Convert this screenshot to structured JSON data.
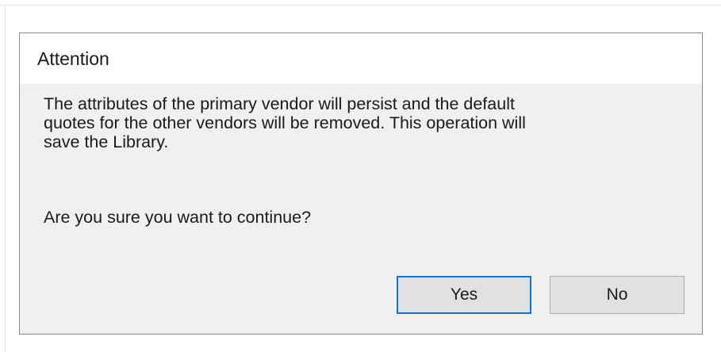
{
  "dialog": {
    "title": "Attention",
    "message_lines": [
      "The attributes of the primary vendor will persist and the default",
      "quotes for the other vendors will be removed.  This operation will",
      "save the Library."
    ],
    "question": "Are you sure you want to continue?",
    "buttons": {
      "yes_label": "Yes",
      "no_label": "No"
    }
  },
  "colors": {
    "accent": "#0078d7",
    "dialog_background": "#f0f0f0",
    "titlebar_background": "#ffffff",
    "button_background": "#e1e1e1"
  }
}
